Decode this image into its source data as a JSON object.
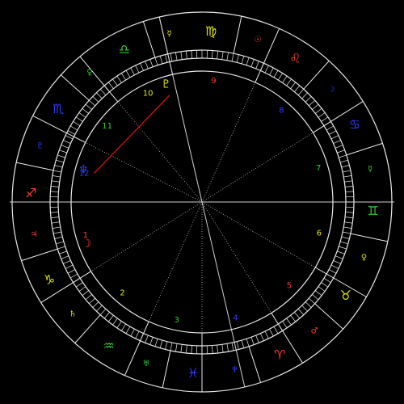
{
  "colors": {
    "background": "#000000",
    "ring": "#e8e8e8",
    "axis": "#cfcfcf",
    "house_line": "#bdbdbd",
    "aspect_line": "#dddddd",
    "fire": "#ff3b30",
    "earth": "#e0e600",
    "air": "#33cc33",
    "water": "#2f3bff",
    "aspect_red": "#cc1010"
  },
  "sign_segments": [
    {
      "name": "sagittarius",
      "glyph": "♐",
      "element": "fire",
      "ruler_glyph": "♃",
      "ruler_color": "fire"
    },
    {
      "name": "capricorn",
      "glyph": "♑",
      "element": "earth",
      "ruler_glyph": "♄",
      "ruler_color": "earth"
    },
    {
      "name": "aquarius",
      "glyph": "♒",
      "element": "air",
      "ruler_glyph": "♅",
      "ruler_color": "air"
    },
    {
      "name": "pisces",
      "glyph": "♓",
      "element": "water",
      "ruler_glyph": "♆",
      "ruler_color": "water"
    },
    {
      "name": "aries",
      "glyph": "♈",
      "element": "fire",
      "ruler_glyph": "♂",
      "ruler_color": "fire"
    },
    {
      "name": "taurus",
      "glyph": "♉",
      "element": "earth",
      "ruler_glyph": "♀",
      "ruler_color": "earth"
    },
    {
      "name": "gemini",
      "glyph": "♊",
      "element": "air",
      "ruler_glyph": "☿",
      "ruler_color": "air"
    },
    {
      "name": "cancer",
      "glyph": "♋",
      "element": "water",
      "ruler_glyph": "☽",
      "ruler_color": "water"
    },
    {
      "name": "leo",
      "glyph": "♌",
      "element": "fire",
      "ruler_glyph": "☉",
      "ruler_color": "fire"
    },
    {
      "name": "virgo",
      "glyph": "♍",
      "element": "earth",
      "ruler_glyph": "☿",
      "ruler_color": "earth"
    },
    {
      "name": "libra",
      "glyph": "♎",
      "element": "air",
      "ruler_glyph": "♀",
      "ruler_color": "air"
    },
    {
      "name": "scorpio",
      "glyph": "♏",
      "element": "water",
      "ruler_glyph": "♇",
      "ruler_color": "water"
    }
  ],
  "houses": [
    {
      "number": "1",
      "color": "fire"
    },
    {
      "number": "2",
      "color": "earth"
    },
    {
      "number": "3",
      "color": "air"
    },
    {
      "number": "4",
      "color": "water"
    },
    {
      "number": "5",
      "color": "fire"
    },
    {
      "number": "6",
      "color": "earth"
    },
    {
      "number": "7",
      "color": "air"
    },
    {
      "number": "8",
      "color": "water"
    },
    {
      "number": "9",
      "color": "fire"
    },
    {
      "number": "10",
      "color": "earth"
    },
    {
      "number": "11",
      "color": "air"
    },
    {
      "number": "12",
      "color": "water"
    }
  ],
  "planets": [
    {
      "name": "pluto",
      "glyph": "♇",
      "color": "earth"
    },
    {
      "name": "neptune",
      "glyph": "♆",
      "color": "water"
    },
    {
      "name": "moon",
      "glyph": "☽",
      "color": "fire"
    }
  ]
}
